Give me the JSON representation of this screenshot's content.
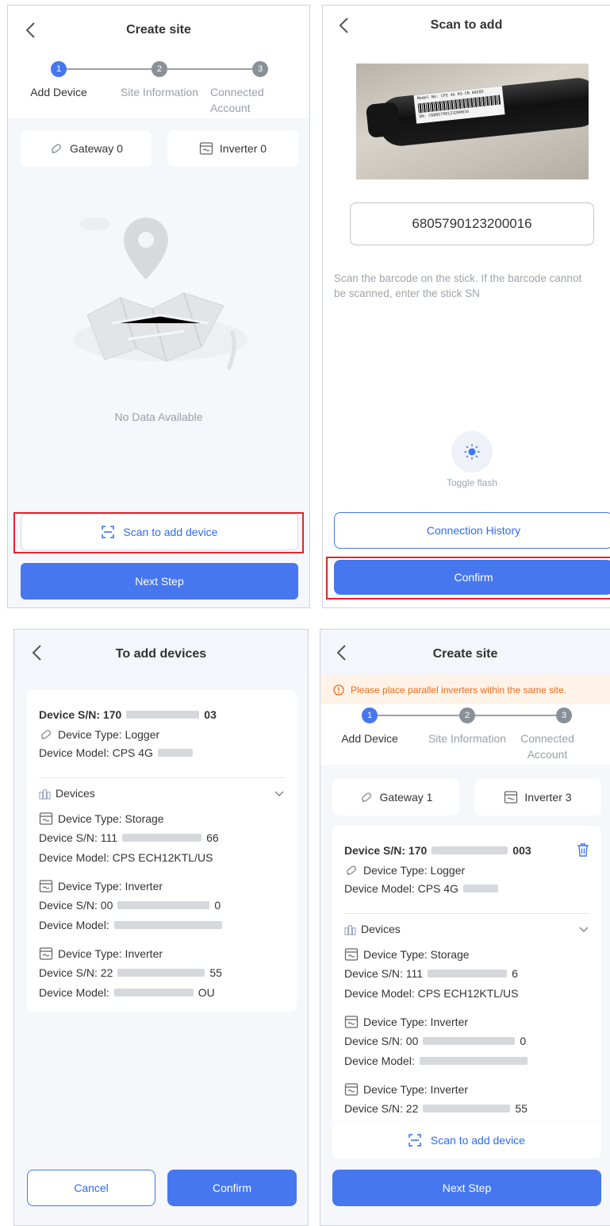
{
  "screen1": {
    "title": "Create site",
    "steps": [
      {
        "num": "1",
        "label": "Add Device"
      },
      {
        "num": "2",
        "label": "Site Information"
      },
      {
        "num": "3",
        "label": "Connected Account"
      }
    ],
    "gateway_chip": "Gateway 0",
    "inverter_chip": "Inverter 0",
    "empty_text": "No Data Available",
    "scan_button": "Scan to add device",
    "next_button": "Next Step"
  },
  "screen2": {
    "title": "Scan to add",
    "sn_value": "6805790123200016",
    "hint": "Scan the barcode on the stick. If the barcode cannot be scanned, enter the stick SN",
    "flash_label": "Toggle flash",
    "history_button": "Connection History",
    "confirm_button": "Confirm",
    "label_line1": "Model No: CPS 4G KS-CN A0285",
    "label_line2": "SN: C6805790123200016"
  },
  "screen3": {
    "title": "To add devices",
    "logger": {
      "sn": "Device S/N: 170",
      "sn_tail": "03",
      "type": "Device Type: Logger",
      "model": "Device Model: CPS 4G"
    },
    "devices_label": "Devices",
    "devices": [
      {
        "type": "Device Type: Storage",
        "sn": "Device S/N: 111",
        "sn_tail": "66",
        "model": "Device Model: CPS ECH12KTL/US",
        "model_tail": ""
      },
      {
        "type": "Device Type: Inverter",
        "sn": "Device S/N: 00",
        "sn_tail": "0",
        "model": "Device Model:",
        "model_tail": ""
      },
      {
        "type": "Device Type: Inverter",
        "sn": "Device S/N: 22",
        "sn_tail": "55",
        "model": "Device Model:",
        "model_tail": "OU"
      }
    ],
    "cancel_button": "Cancel",
    "confirm_button": "Confirm"
  },
  "screen4": {
    "title": "Create site",
    "warning": "Please place parallel inverters within the same site.",
    "steps": [
      {
        "num": "1",
        "label": "Add Device"
      },
      {
        "num": "2",
        "label": "Site Information"
      },
      {
        "num": "3",
        "label": "Connected Account"
      }
    ],
    "gateway_chip": "Gateway 1",
    "inverter_chip": "Inverter 3",
    "logger": {
      "sn": "Device S/N: 170",
      "sn_tail": "003",
      "type": "Device Type: Logger",
      "model": "Device Model: CPS 4G"
    },
    "devices_label": "Devices",
    "devices": [
      {
        "type": "Device Type: Storage",
        "sn": "Device S/N: 111",
        "sn_tail": "6",
        "model": "Device Model: CPS ECH12KTL/US"
      },
      {
        "type": "Device Type: Inverter",
        "sn": "Device S/N: 00",
        "sn_tail": "0",
        "model": "Device Model:"
      },
      {
        "type": "Device Type: Inverter",
        "sn": "Device S/N: 22",
        "sn_tail": "55"
      }
    ],
    "scan_button": "Scan to add device",
    "next_button": "Next Step"
  },
  "colors": {
    "primary": "#4677ee",
    "highlight": "#e0262b",
    "warning": "#f06a1d",
    "warning_bg": "#fff3e8"
  },
  "icons": {
    "back": "chevron-left-icon",
    "gateway": "logger-stick-icon",
    "inverter": "inverter-icon",
    "scan": "scan-frame-icon",
    "flash": "sun-icon",
    "devices": "devices-group-icon",
    "expand": "chevron-down-icon",
    "delete": "trash-icon",
    "warning": "info-circle-icon"
  }
}
